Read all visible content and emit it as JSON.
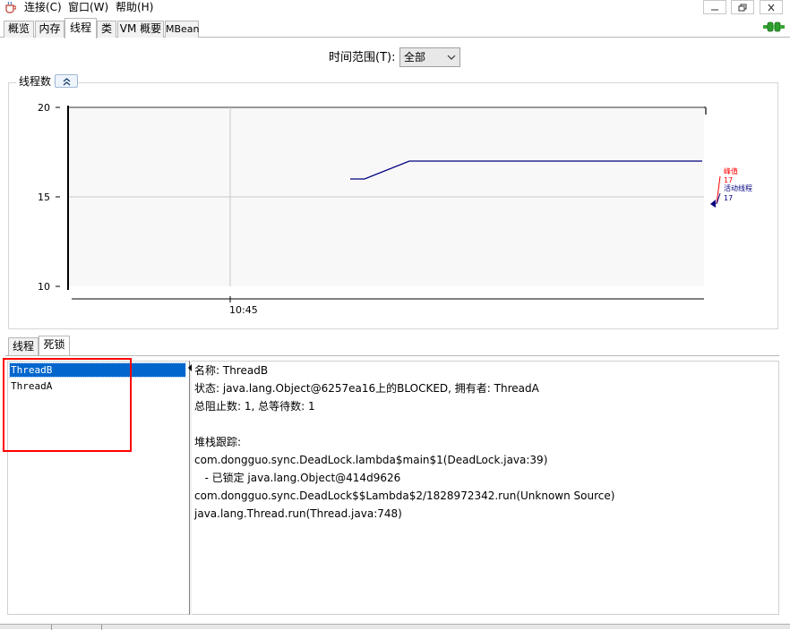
{
  "menubar": {
    "items": [
      {
        "label": "连接(C)"
      },
      {
        "label": "窗口(W)"
      },
      {
        "label": "帮助(H)"
      }
    ],
    "window_controls": [
      "minimize-icon",
      "restore-icon",
      "close-icon"
    ]
  },
  "main_tabs": [
    {
      "label": "概览"
    },
    {
      "label": "内存"
    },
    {
      "label": "线程",
      "active": true
    },
    {
      "label": "类"
    },
    {
      "label": "VM 概要"
    },
    {
      "label": "MBean"
    }
  ],
  "time_range": {
    "label": "时间范围(T):",
    "selected": "全部"
  },
  "chart_panel": {
    "title": "线程数"
  },
  "chart_data": {
    "type": "line",
    "ylim": [
      10,
      20
    ],
    "y_ticks": [
      "10",
      "15",
      "20"
    ],
    "x_ticks": [
      "10:45"
    ],
    "grid": true,
    "legend_position": "right",
    "series": [
      {
        "name": "峰值",
        "color": "#ff0000",
        "last_value": "17"
      },
      {
        "name": "活动线程",
        "color": "#000080",
        "last_value": "17",
        "points": [
          16,
          16,
          17,
          17,
          17,
          17,
          17,
          17
        ]
      }
    ]
  },
  "sub_tabs": [
    {
      "label": "线程"
    },
    {
      "label": "死锁",
      "active": true
    }
  ],
  "thread_list": [
    {
      "name": "ThreadB",
      "selected": true
    },
    {
      "name": "ThreadA"
    }
  ],
  "detail": {
    "lines": [
      "名称: ThreadB",
      "状态: java.lang.Object@6257ea16上的BLOCKED, 拥有者: ThreadA",
      "总阻止数: 1, 总等待数: 1",
      "",
      "堆栈跟踪:",
      "com.dongguo.sync.DeadLock.lambda$main$1(DeadLock.java:39)",
      "   - 已锁定 java.lang.Object@414d9626",
      "com.dongguo.sync.DeadLock$$Lambda$2/1828972342.run(Unknown Source)",
      "java.lang.Thread.run(Thread.java:748)"
    ]
  },
  "colors": {
    "selection": "#0066cc",
    "highlight_box": "#ff0000",
    "chart_background": "#f8f8f8"
  }
}
